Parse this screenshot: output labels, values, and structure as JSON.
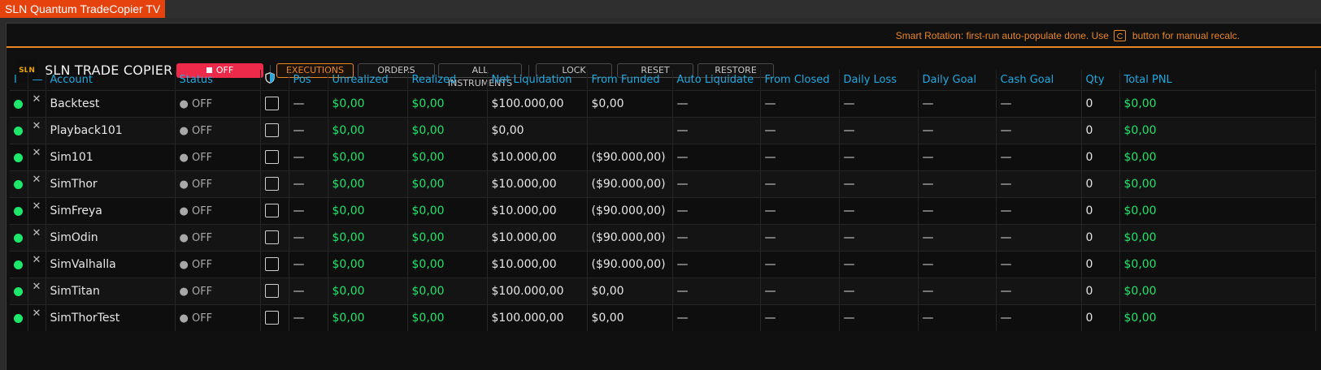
{
  "window": {
    "title": "SLN Quantum TradeCopier TV"
  },
  "notice": {
    "before": "Smart Rotation: first-run auto-populate done. Use",
    "after": "button for manual recalc."
  },
  "toolbar": {
    "logo": "SLN",
    "brand": "SLN TRADE COPIER",
    "power_label": "OFF",
    "executions": "EXECUTIONS",
    "orders": "ORDERS",
    "all_instruments": "ALL INSTRUMENTS",
    "lock": "LOCK",
    "reset": "RESET",
    "restore": "RESTORE"
  },
  "columns": {
    "indicator": "I",
    "remove": "—",
    "account": "Account",
    "status": "Status",
    "pos": "Pos",
    "unrealized": "Unrealized",
    "realized": "Realized",
    "net_liquidation": "Net Liquidation",
    "from_funded": "From Funded",
    "auto_liquidate": "Auto Liquidate",
    "from_closed": "From Closed",
    "daily_loss": "Daily Loss",
    "daily_goal": "Daily Goal",
    "cash_goal": "Cash Goal",
    "qty": "Qty",
    "total_pnl": "Total PNL"
  },
  "rows": [
    {
      "remove": "✕",
      "account": "Backtest",
      "status": "● OFF",
      "pos": "—",
      "unrealized": "$0,00",
      "realized": "$0,00",
      "net_liquidation": "$100.000,00",
      "from_funded": "$0,00",
      "auto_liquidate": "—",
      "from_closed": "—",
      "daily_loss": "—",
      "daily_goal": "—",
      "cash_goal": "—",
      "qty": "0",
      "total_pnl": "$0,00"
    },
    {
      "remove": "✕",
      "account": "Playback101",
      "status": "● OFF",
      "pos": "—",
      "unrealized": "$0,00",
      "realized": "$0,00",
      "net_liquidation": "$0,00",
      "from_funded": "",
      "auto_liquidate": "—",
      "from_closed": "—",
      "daily_loss": "—",
      "daily_goal": "—",
      "cash_goal": "—",
      "qty": "0",
      "total_pnl": "$0,00"
    },
    {
      "remove": "✕",
      "account": "Sim101",
      "status": "● OFF",
      "pos": "—",
      "unrealized": "$0,00",
      "realized": "$0,00",
      "net_liquidation": "$10.000,00",
      "from_funded": "($90.000,00)",
      "auto_liquidate": "—",
      "from_closed": "—",
      "daily_loss": "—",
      "daily_goal": "—",
      "cash_goal": "—",
      "qty": "0",
      "total_pnl": "$0,00"
    },
    {
      "remove": "✕",
      "account": "SimThor",
      "status": "● OFF",
      "pos": "—",
      "unrealized": "$0,00",
      "realized": "$0,00",
      "net_liquidation": "$10.000,00",
      "from_funded": "($90.000,00)",
      "auto_liquidate": "—",
      "from_closed": "—",
      "daily_loss": "—",
      "daily_goal": "—",
      "cash_goal": "—",
      "qty": "0",
      "total_pnl": "$0,00"
    },
    {
      "remove": "✕",
      "account": "SimFreya",
      "status": "● OFF",
      "pos": "—",
      "unrealized": "$0,00",
      "realized": "$0,00",
      "net_liquidation": "$10.000,00",
      "from_funded": "($90.000,00)",
      "auto_liquidate": "—",
      "from_closed": "—",
      "daily_loss": "—",
      "daily_goal": "—",
      "cash_goal": "—",
      "qty": "0",
      "total_pnl": "$0,00"
    },
    {
      "remove": "✕",
      "account": "SimOdin",
      "status": "● OFF",
      "pos": "—",
      "unrealized": "$0,00",
      "realized": "$0,00",
      "net_liquidation": "$10.000,00",
      "from_funded": "($90.000,00)",
      "auto_liquidate": "—",
      "from_closed": "—",
      "daily_loss": "—",
      "daily_goal": "—",
      "cash_goal": "—",
      "qty": "0",
      "total_pnl": "$0,00"
    },
    {
      "remove": "✕",
      "account": "SimValhalla",
      "status": "● OFF",
      "pos": "—",
      "unrealized": "$0,00",
      "realized": "$0,00",
      "net_liquidation": "$10.000,00",
      "from_funded": "($90.000,00)",
      "auto_liquidate": "—",
      "from_closed": "—",
      "daily_loss": "—",
      "daily_goal": "—",
      "cash_goal": "—",
      "qty": "0",
      "total_pnl": "$0,00"
    },
    {
      "remove": "✕",
      "account": "SimTitan",
      "status": "● OFF",
      "pos": "—",
      "unrealized": "$0,00",
      "realized": "$0,00",
      "net_liquidation": "$100.000,00",
      "from_funded": "$0,00",
      "auto_liquidate": "—",
      "from_closed": "—",
      "daily_loss": "—",
      "daily_goal": "—",
      "cash_goal": "—",
      "qty": "0",
      "total_pnl": "$0,00"
    },
    {
      "remove": "✕",
      "account": "SimThorTest",
      "status": "● OFF",
      "pos": "—",
      "unrealized": "$0,00",
      "realized": "$0,00",
      "net_liquidation": "$100.000,00",
      "from_funded": "$0,00",
      "auto_liquidate": "—",
      "from_closed": "—",
      "daily_loss": "—",
      "daily_goal": "—",
      "cash_goal": "—",
      "qty": "0",
      "total_pnl": "$0,00"
    }
  ],
  "colors": {
    "accent": "#e8862a",
    "header": "#23a9de",
    "profit": "#23e26b",
    "power": "#ee2a4a",
    "tab": "#e5420d"
  },
  "icons": {
    "notice_button": "recalc-icon",
    "protect_column": "shield-icon",
    "row_status": "green-dot-icon",
    "row_remove": "close-icon"
  }
}
